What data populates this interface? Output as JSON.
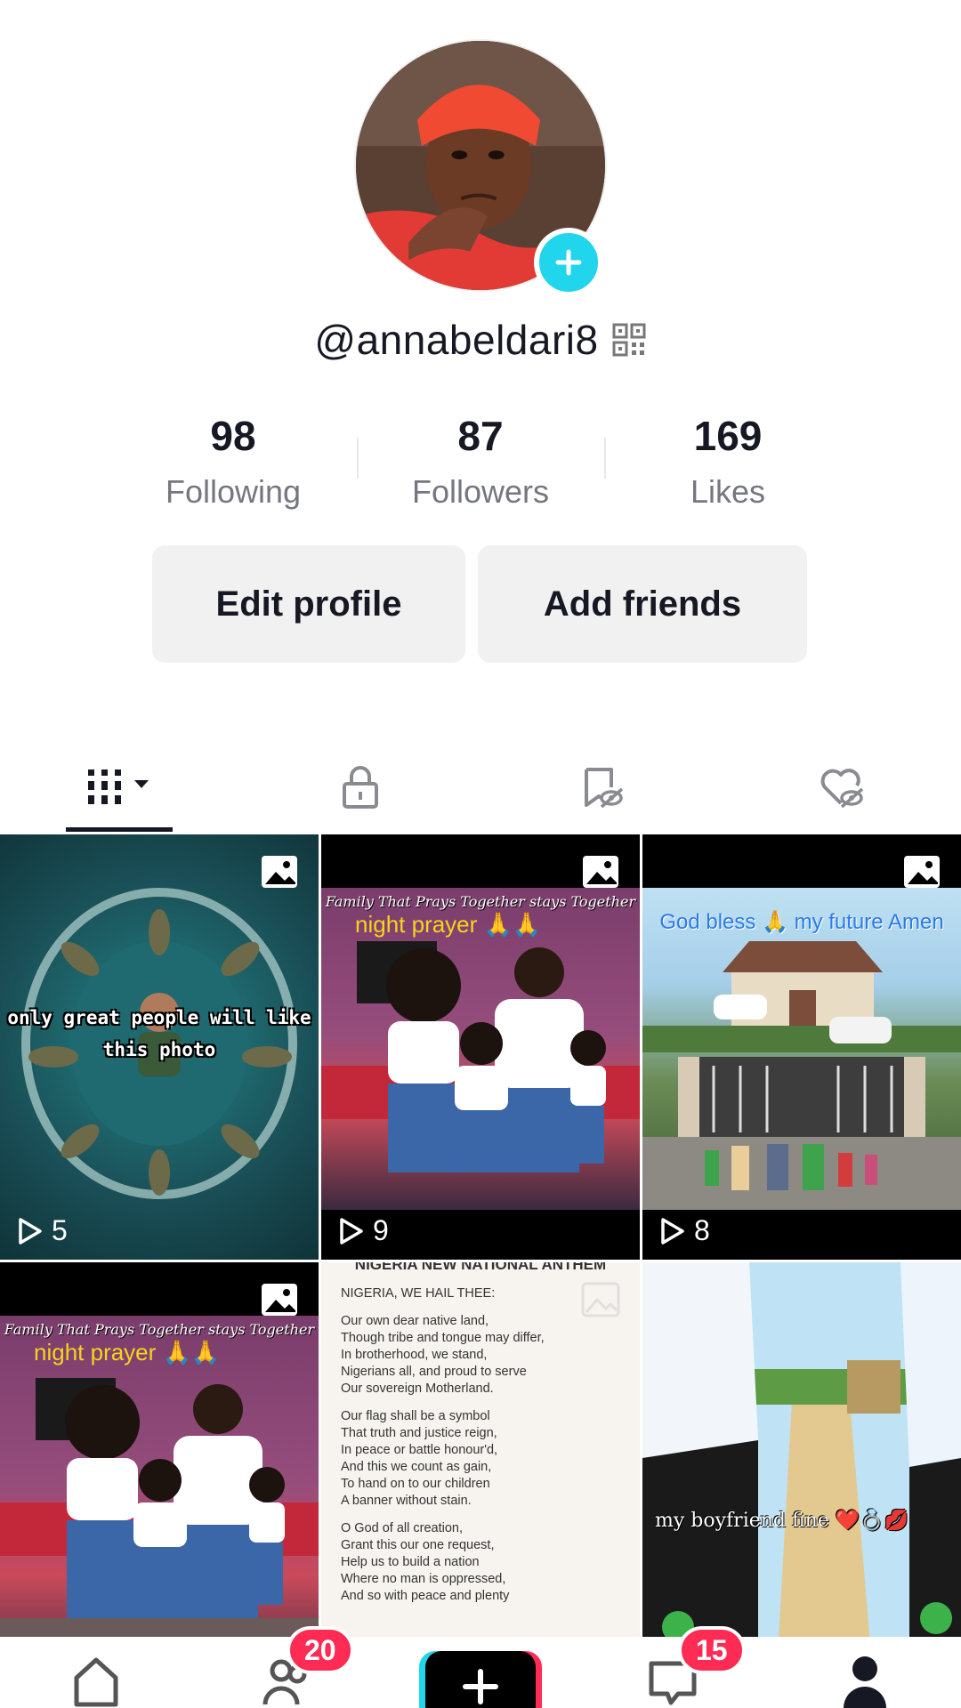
{
  "profile": {
    "username": "@annabeldari8",
    "stats": [
      {
        "value": "98",
        "label": "Following"
      },
      {
        "value": "87",
        "label": "Followers"
      },
      {
        "value": "169",
        "label": "Likes"
      }
    ],
    "edit_label": "Edit profile",
    "add_friends_label": "Add friends"
  },
  "tabs": [
    {
      "icon": "grid-icon",
      "active": true
    },
    {
      "icon": "lock-icon"
    },
    {
      "icon": "bookmark-hidden-icon"
    },
    {
      "icon": "heart-hidden-icon"
    }
  ],
  "videos": [
    {
      "caption": "only great people will like this photo",
      "plays": "5"
    },
    {
      "caption_cursive": "Family That Prays Together stays Together",
      "caption": "night prayer 🙏🙏",
      "plays": "9"
    },
    {
      "caption": "God bless 🙏 my future Amen",
      "plays": "8"
    },
    {
      "caption_cursive": "Family That Prays Together stays Together",
      "caption": "night prayer 🙏🙏"
    },
    {
      "title": "NIGERIA NEW NATIONAL ANTHEM",
      "lines": [
        "NIGERIA, WE HAIL THEE:",
        "Our own dear native land,\nThough tribe and tongue may differ,\nIn brotherhood, we stand,\nNigerians all, and proud to serve\nOur sovereign Motherland.",
        "Our flag shall be a symbol\nThat truth and justice reign,\nIn peace or battle honour'd,\nAnd this we count as gain,\nTo hand on to our children\nA banner without stain.",
        "O God of all creation,\nGrant this our one request,\nHelp us to build a nation\nWhere no man is oppressed,\nAnd so with peace and plenty"
      ]
    },
    {
      "caption": "my boyfriend fine ❤️💍💋"
    }
  ],
  "nav": {
    "friends_badge": "20",
    "inbox_badge": "15"
  },
  "colors": {
    "accent": "#fe2c55",
    "cyan": "#20d5ec",
    "text": "#161823",
    "muted": "#757680"
  }
}
